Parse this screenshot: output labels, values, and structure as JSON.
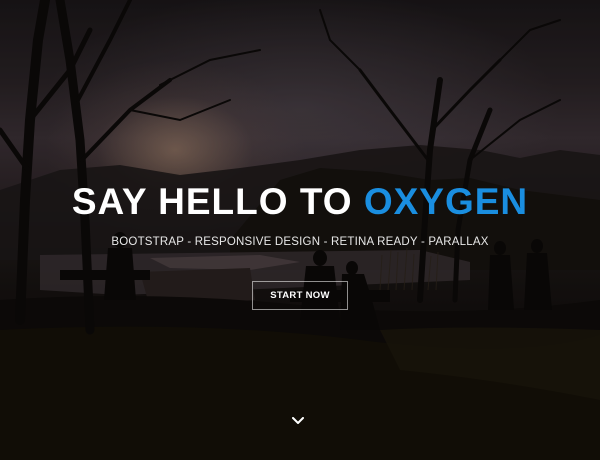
{
  "hero": {
    "title_main": "SAY HELLO TO ",
    "title_accent": "OXYGEN",
    "tagline": "BOOTSTRAP - RESPONSIVE DESIGN - RETINA READY - PARALLAX",
    "cta_label": "START NOW",
    "scroll_icon": "chevron-down-icon",
    "accent_color": "#1a8ee0"
  }
}
